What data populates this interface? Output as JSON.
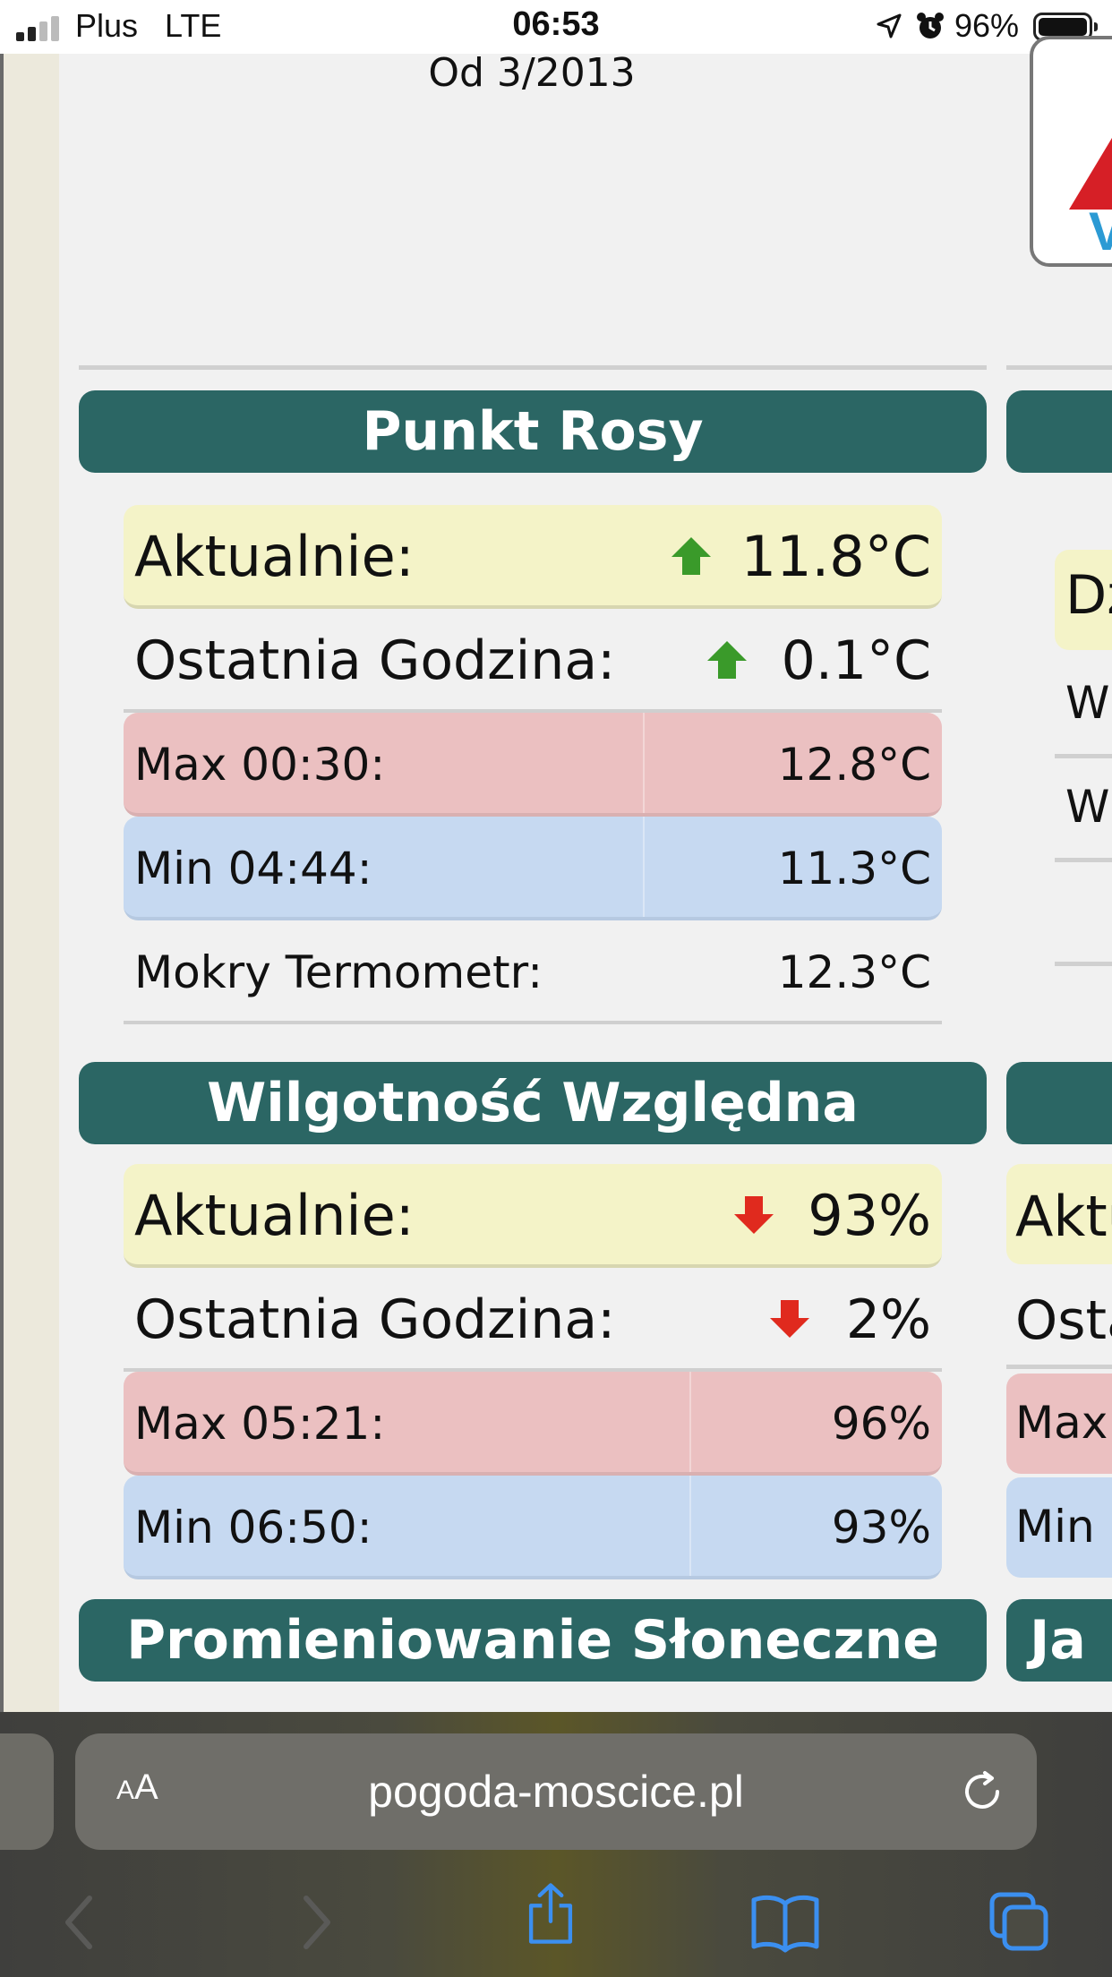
{
  "status_bar": {
    "carrier": "Plus",
    "network": "LTE",
    "time": "06:53",
    "battery_percent": "96%",
    "battery_level": 0.96,
    "signal_bars": 2
  },
  "header": {
    "since": "Od 3/2013"
  },
  "sections": {
    "dew_point": {
      "title": "Punkt Rosy",
      "rows": {
        "current_label": "Aktualnie:",
        "current_value": "11.8°C",
        "current_trend": "up",
        "last_hour_label": "Ostatnia Godzina:",
        "last_hour_value": "0.1°C",
        "last_hour_trend": "up",
        "max_label": "Max 00:30:",
        "max_value": "12.8°C",
        "min_label": "Min 04:44:",
        "min_value": "11.3°C",
        "wet_label": "Mokry Termometr:",
        "wet_value": "12.3°C"
      }
    },
    "humidity": {
      "title": "Wilgotność Względna",
      "rows": {
        "current_label": "Aktualnie:",
        "current_value": "93%",
        "current_trend": "down",
        "last_hour_label": "Ostatnia Godzina:",
        "last_hour_value": "2%",
        "last_hour_trend": "down",
        "max_label": "Max 05:21:",
        "max_value": "96%",
        "min_label": "Min 06:50:",
        "min_value": "93%"
      }
    },
    "solar": {
      "title": "Promieniowanie Słoneczne"
    }
  },
  "right_column_partial": {
    "row_a": "Dz",
    "row_b": "W",
    "row_c": "W",
    "current": "Aktu",
    "last_hour": "Osta",
    "max": "Max",
    "min": "Min",
    "header_bottom": "Ja"
  },
  "browser": {
    "aa_label_small": "A",
    "aa_label_big": "A",
    "url": "pogoda-moscice.pl"
  },
  "colors": {
    "header_bg": "#2b6664",
    "current_row": "#f4f3c8",
    "max_row": "#ebc0c1",
    "min_row": "#c6d9f1",
    "trend_up": "#3a9a2a",
    "trend_down": "#e02a1e",
    "link_blue": "#3b8ff0"
  }
}
